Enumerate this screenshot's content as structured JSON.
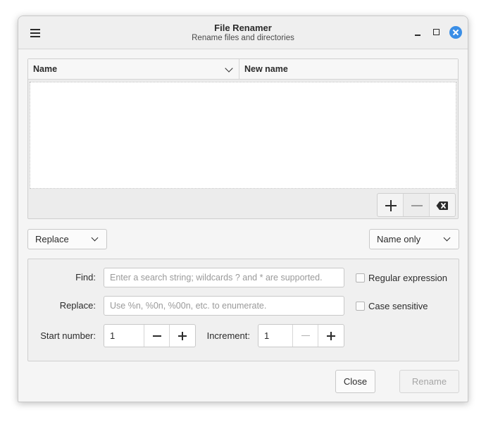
{
  "window": {
    "title": "File Renamer",
    "subtitle": "Rename files and directories",
    "close_color": "#3a8ee6"
  },
  "titlebar_controls": {
    "menu_icon": "hamburger-menu-icon",
    "minimize_icon": "minimize-icon",
    "maximize_icon": "maximize-icon",
    "close_icon": "close-icon"
  },
  "file_list": {
    "columns": [
      "Name",
      "New name"
    ],
    "rows": [],
    "toolbar": {
      "add_icon": "plus-icon",
      "remove_icon": "minus-icon",
      "clear_icon": "backspace-clear-icon"
    }
  },
  "mode_select": {
    "selected": "Replace"
  },
  "scope_select": {
    "selected": "Name only"
  },
  "form": {
    "find_label": "Find:",
    "find_placeholder": "Enter a search string; wildcards ? and * are supported.",
    "find_value": "",
    "replace_label": "Replace:",
    "replace_placeholder": "Use %n, %0n, %00n, etc. to enumerate.",
    "replace_value": "",
    "regex_label": "Regular expression",
    "regex_checked": false,
    "case_label": "Case sensitive",
    "case_checked": false,
    "start_label": "Start number:",
    "start_value": "1",
    "increment_label": "Increment:",
    "increment_value": "1"
  },
  "footer": {
    "close_label": "Close",
    "rename_label": "Rename",
    "rename_enabled": false
  }
}
